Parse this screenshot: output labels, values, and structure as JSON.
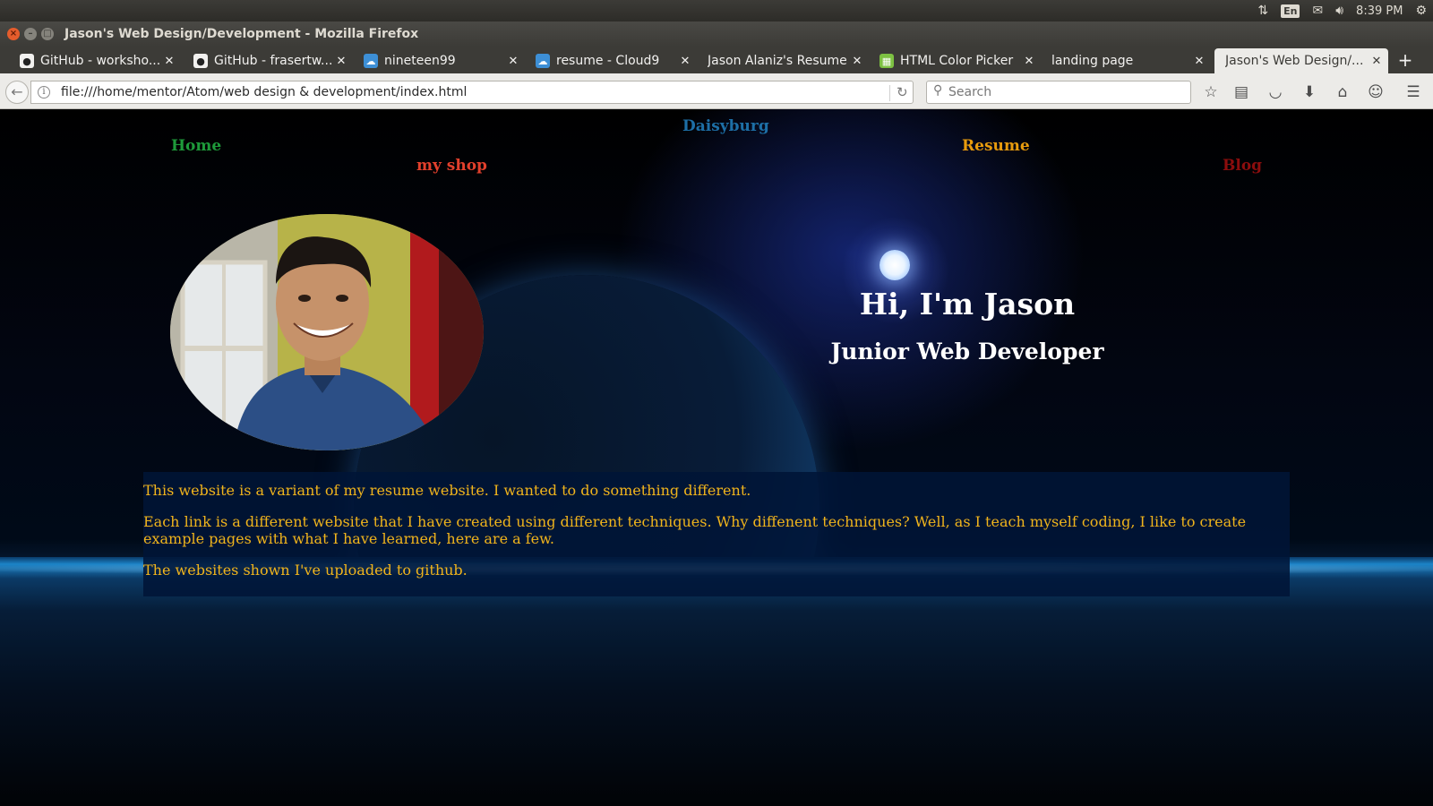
{
  "system_bar": {
    "keyboard_layout": "En",
    "clock": "8:39 PM",
    "icons": [
      "network-arrows-icon",
      "keyboard-layout-icon",
      "mail-icon",
      "volume-icon",
      "power-gear-icon"
    ]
  },
  "window": {
    "title": "Jason's Web Design/Development - Mozilla Firefox"
  },
  "tabs": [
    {
      "label": "GitHub - worksho...",
      "icon": "github-icon"
    },
    {
      "label": "GitHub - frasertw...",
      "icon": "github-icon"
    },
    {
      "label": "nineteen99",
      "icon": "cloud9-icon"
    },
    {
      "label": "resume - Cloud9",
      "icon": "cloud9-icon"
    },
    {
      "label": "Jason Alaniz's Resume",
      "icon": ""
    },
    {
      "label": "HTML Color Picker",
      "icon": "color-picker-icon"
    },
    {
      "label": "landing page",
      "icon": ""
    },
    {
      "label": "Jason's Web Design/...",
      "icon": "",
      "active": true
    }
  ],
  "toolbar": {
    "url": "file:///home/mentor/Atom/web design & development/index.html",
    "search_placeholder": "Search"
  },
  "site": {
    "name": "Daisyburg",
    "nav": {
      "home": "Home",
      "shop": "my shop",
      "resume": "Resume",
      "blog": "Blog"
    },
    "hero": {
      "title": "Hi, I'm Jason",
      "subtitle": "Junior Web Developer"
    },
    "about": [
      "This website is a variant of my resume website. I wanted to do something different.",
      "Each link is a different website that I have created using different techniques. Why diffenent techniques? Well, as I teach myself coding, I like to create example pages with what I have learned, here are a few.",
      "The websites shown I've uploaded to github."
    ]
  },
  "colors": {
    "site_name": "#1d6fa6",
    "home": "#1e9a3a",
    "shop": "#e2402c",
    "resume": "#e89b0d",
    "blog": "#8c0d0d",
    "about_text": "#f0b41c",
    "about_bg": "#001437"
  }
}
